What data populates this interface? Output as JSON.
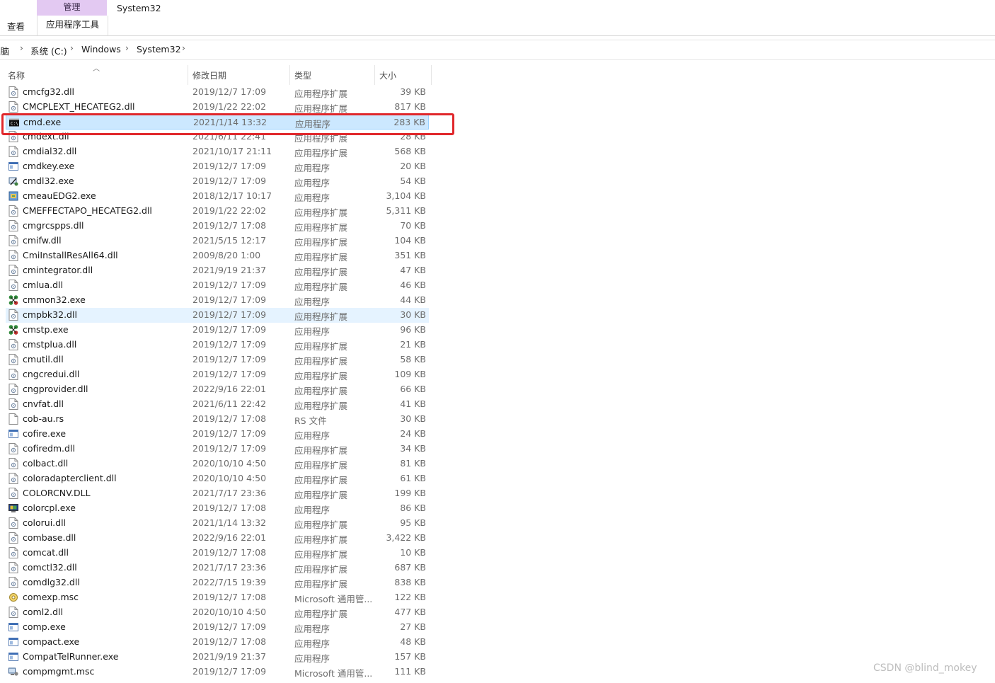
{
  "ribbon": {
    "manage_label": "管理",
    "window_title": "System32",
    "view_tab": "查看",
    "app_tools_tab": "应用程序工具"
  },
  "address": {
    "crumbs": [
      "电脑",
      "系统 (C:)",
      "Windows",
      "System32"
    ]
  },
  "columns": {
    "name": "名称",
    "date": "修改日期",
    "type": "类型",
    "size": "大小"
  },
  "files": [
    {
      "name": "cmcfg32.dll",
      "date": "2019/12/7 17:09",
      "type": "应用程序扩展",
      "size": "39 KB",
      "icon": "dll-icon"
    },
    {
      "name": "CMCPLEXT_HECATEG2.dll",
      "date": "2019/1/22 22:02",
      "type": "应用程序扩展",
      "size": "817 KB",
      "icon": "dll-icon"
    },
    {
      "name": "cmd.exe",
      "date": "2021/1/14 13:32",
      "type": "应用程序",
      "size": "283 KB",
      "icon": "cmd-icon"
    },
    {
      "name": "cmdext.dll",
      "date": "2021/6/11 22:41",
      "type": "应用程序扩展",
      "size": "28 KB",
      "icon": "dll-icon"
    },
    {
      "name": "cmdial32.dll",
      "date": "2021/10/17 21:11",
      "type": "应用程序扩展",
      "size": "568 KB",
      "icon": "dll-icon"
    },
    {
      "name": "cmdkey.exe",
      "date": "2019/12/7 17:09",
      "type": "应用程序",
      "size": "20 KB",
      "icon": "exe-icon"
    },
    {
      "name": "cmdl32.exe",
      "date": "2019/12/7 17:09",
      "type": "应用程序",
      "size": "54 KB",
      "icon": "connection-icon"
    },
    {
      "name": "cmeauEDG2.exe",
      "date": "2018/12/17 10:17",
      "type": "应用程序",
      "size": "3,104 KB",
      "icon": "installer-icon"
    },
    {
      "name": "CMEFFECTAPO_HECATEG2.dll",
      "date": "2019/1/22 22:02",
      "type": "应用程序扩展",
      "size": "5,311 KB",
      "icon": "dll-icon"
    },
    {
      "name": "cmgrcspps.dll",
      "date": "2019/12/7 17:08",
      "type": "应用程序扩展",
      "size": "70 KB",
      "icon": "dll-icon"
    },
    {
      "name": "cmifw.dll",
      "date": "2021/5/15 12:17",
      "type": "应用程序扩展",
      "size": "104 KB",
      "icon": "dll-icon"
    },
    {
      "name": "CmiInstallResAll64.dll",
      "date": "2009/8/20 1:00",
      "type": "应用程序扩展",
      "size": "351 KB",
      "icon": "dll-icon"
    },
    {
      "name": "cmintegrator.dll",
      "date": "2021/9/19 21:37",
      "type": "应用程序扩展",
      "size": "47 KB",
      "icon": "dll-icon"
    },
    {
      "name": "cmlua.dll",
      "date": "2019/12/7 17:09",
      "type": "应用程序扩展",
      "size": "46 KB",
      "icon": "dll-icon"
    },
    {
      "name": "cmmon32.exe",
      "date": "2019/12/7 17:09",
      "type": "应用程序",
      "size": "44 KB",
      "icon": "network-icon"
    },
    {
      "name": "cmpbk32.dll",
      "date": "2019/12/7 17:09",
      "type": "应用程序扩展",
      "size": "30 KB",
      "icon": "dll-icon"
    },
    {
      "name": "cmstp.exe",
      "date": "2019/12/7 17:09",
      "type": "应用程序",
      "size": "96 KB",
      "icon": "network-icon"
    },
    {
      "name": "cmstplua.dll",
      "date": "2019/12/7 17:09",
      "type": "应用程序扩展",
      "size": "21 KB",
      "icon": "dll-icon"
    },
    {
      "name": "cmutil.dll",
      "date": "2019/12/7 17:09",
      "type": "应用程序扩展",
      "size": "58 KB",
      "icon": "dll-icon"
    },
    {
      "name": "cngcredui.dll",
      "date": "2019/12/7 17:09",
      "type": "应用程序扩展",
      "size": "109 KB",
      "icon": "dll-icon"
    },
    {
      "name": "cngprovider.dll",
      "date": "2022/9/16 22:01",
      "type": "应用程序扩展",
      "size": "66 KB",
      "icon": "dll-icon"
    },
    {
      "name": "cnvfat.dll",
      "date": "2021/6/11 22:42",
      "type": "应用程序扩展",
      "size": "41 KB",
      "icon": "dll-icon"
    },
    {
      "name": "cob-au.rs",
      "date": "2019/12/7 17:08",
      "type": "RS 文件",
      "size": "30 KB",
      "icon": "file-icon"
    },
    {
      "name": "cofire.exe",
      "date": "2019/12/7 17:09",
      "type": "应用程序",
      "size": "24 KB",
      "icon": "exe-icon"
    },
    {
      "name": "cofiredm.dll",
      "date": "2019/12/7 17:09",
      "type": "应用程序扩展",
      "size": "34 KB",
      "icon": "dll-icon"
    },
    {
      "name": "colbact.dll",
      "date": "2020/10/10 4:50",
      "type": "应用程序扩展",
      "size": "81 KB",
      "icon": "dll-icon"
    },
    {
      "name": "coloradapterclient.dll",
      "date": "2020/10/10 4:50",
      "type": "应用程序扩展",
      "size": "61 KB",
      "icon": "dll-icon"
    },
    {
      "name": "COLORCNV.DLL",
      "date": "2021/7/17 23:36",
      "type": "应用程序扩展",
      "size": "199 KB",
      "icon": "dll-icon"
    },
    {
      "name": "colorcpl.exe",
      "date": "2019/12/7 17:08",
      "type": "应用程序",
      "size": "86 KB",
      "icon": "monitor-icon"
    },
    {
      "name": "colorui.dll",
      "date": "2021/1/14 13:32",
      "type": "应用程序扩展",
      "size": "95 KB",
      "icon": "dll-icon"
    },
    {
      "name": "combase.dll",
      "date": "2022/9/16 22:01",
      "type": "应用程序扩展",
      "size": "3,422 KB",
      "icon": "dll-icon"
    },
    {
      "name": "comcat.dll",
      "date": "2019/12/7 17:08",
      "type": "应用程序扩展",
      "size": "10 KB",
      "icon": "dll-icon"
    },
    {
      "name": "comctl32.dll",
      "date": "2021/7/17 23:36",
      "type": "应用程序扩展",
      "size": "687 KB",
      "icon": "dll-icon"
    },
    {
      "name": "comdlg32.dll",
      "date": "2022/7/15 19:39",
      "type": "应用程序扩展",
      "size": "838 KB",
      "icon": "dll-icon"
    },
    {
      "name": "comexp.msc",
      "date": "2019/12/7 17:08",
      "type": "Microsoft 通用管...",
      "size": "122 KB",
      "icon": "msc-icon"
    },
    {
      "name": "coml2.dll",
      "date": "2020/10/10 4:50",
      "type": "应用程序扩展",
      "size": "477 KB",
      "icon": "dll-icon"
    },
    {
      "name": "comp.exe",
      "date": "2019/12/7 17:09",
      "type": "应用程序",
      "size": "27 KB",
      "icon": "exe-icon"
    },
    {
      "name": "compact.exe",
      "date": "2019/12/7 17:08",
      "type": "应用程序",
      "size": "48 KB",
      "icon": "exe-icon"
    },
    {
      "name": "CompatTelRunner.exe",
      "date": "2021/9/19 21:37",
      "type": "应用程序",
      "size": "157 KB",
      "icon": "exe-icon"
    },
    {
      "name": "compmgmt.msc",
      "date": "2019/12/7 17:09",
      "type": "Microsoft 通用管...",
      "size": "111 KB",
      "icon": "computer-mgmt-icon"
    }
  ],
  "selected_index": 2,
  "hover_index": 15,
  "colors": {
    "selected_bg": "#cce8ff",
    "hover_bg": "#e5f3ff",
    "manage_tab": "#e3c9f2",
    "highlight_box": "#e0272b"
  },
  "watermark": "CSDN @blind_mokey"
}
